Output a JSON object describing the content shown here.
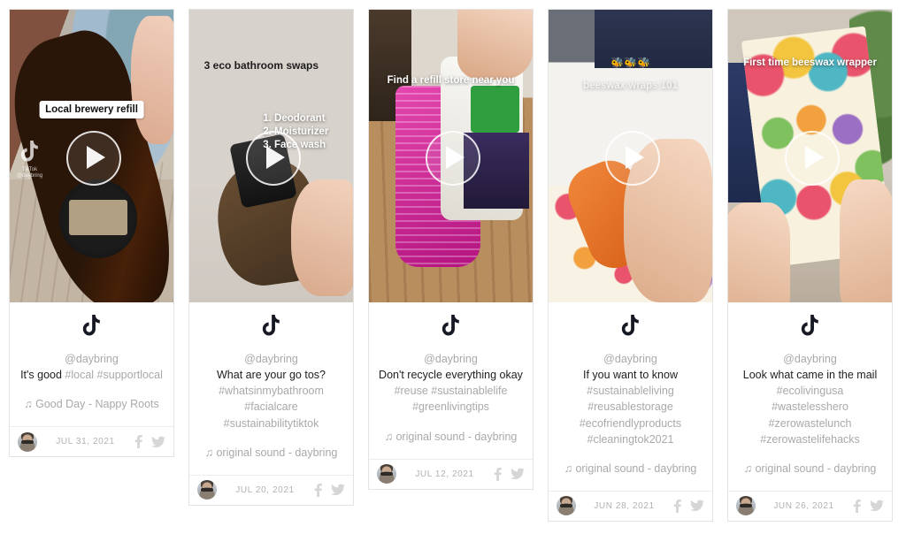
{
  "feed": {
    "platform_icon": "tiktok-note-icon",
    "cards": [
      {
        "overlay": {
          "style": "box",
          "text": "Local brewery refill",
          "watermark": "TikTok",
          "watermark_handle": "@daybring"
        },
        "handle": "@daybring",
        "caption_lead": "It's good",
        "caption_tags": "#local #supportlocal",
        "sound": "♫ Good Day - Nappy Roots",
        "date": "JUL 31, 2021",
        "share": [
          "facebook-icon",
          "twitter-icon"
        ]
      },
      {
        "overlay": {
          "style": "plain-dark",
          "text": "3 eco bathroom swaps",
          "list": "1. Deodorant\n2. Moisturizer\n3. Face wash"
        },
        "handle": "@daybring",
        "caption_lead": "What are your go tos?",
        "caption_tags": "#whatsinmybathroom #facialcare #sustainabilitytiktok",
        "sound": "♫ original sound - daybring",
        "date": "JUL 20, 2021",
        "share": [
          "facebook-icon",
          "twitter-icon"
        ]
      },
      {
        "overlay": {
          "style": "white-shadow",
          "text": "Find a refill store near you"
        },
        "handle": "@daybring",
        "caption_lead": "Don't recycle everything okay",
        "caption_tags": "#reuse #sustainablelife #greenlivingtips",
        "sound": "♫ original sound - daybring",
        "date": "JUL 12, 2021",
        "share": [
          "facebook-icon",
          "twitter-icon"
        ]
      },
      {
        "overlay": {
          "style": "soft-white",
          "emoji": "🐝🐝🐝",
          "text": "beeswax wraps 101"
        },
        "handle": "@daybring",
        "caption_lead": "If you want to know",
        "caption_tags": "#sustainableliving #reusablestorage #ecofriendlyproducts #cleaningtok2021",
        "sound": "♫ original sound - daybring",
        "date": "JUN 28, 2021",
        "share": [
          "facebook-icon",
          "twitter-icon"
        ]
      },
      {
        "overlay": {
          "style": "white-shadow",
          "text": "First time beeswax wrapper"
        },
        "handle": "@daybring",
        "caption_lead": "Look what came in the mail",
        "caption_tags": "#ecolivingusa #wastelesshero #zerowastelunch #zerowastelifehacks",
        "sound": "♫ original sound - daybring",
        "date": "JUN 26, 2021",
        "share": [
          "facebook-icon",
          "twitter-icon"
        ]
      }
    ]
  },
  "colors": {
    "background": "#ffffff",
    "card_border": "#e3e3e3",
    "muted_text": "#a9a9a9",
    "lead_text": "#1e1e1e",
    "date_text": "#b2b2b2",
    "social_icon": "#d6d6d6"
  }
}
